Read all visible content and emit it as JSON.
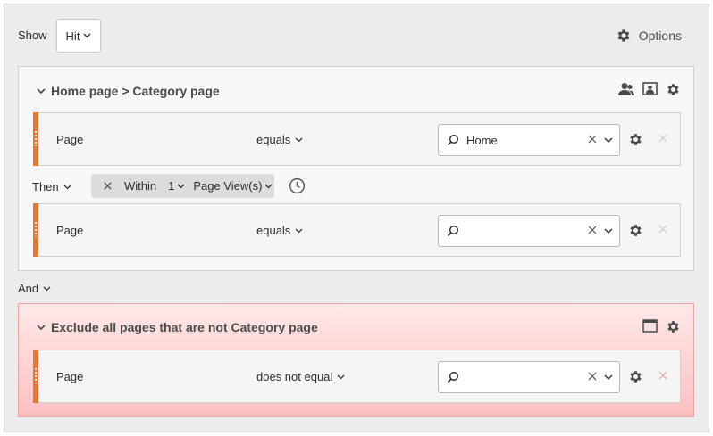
{
  "toolbar": {
    "show_label": "Show",
    "show_value": "Hit",
    "options_label": "Options"
  },
  "sequence_container": {
    "title": "Home page > Category page",
    "rules": [
      {
        "field": "Page",
        "operator": "equals",
        "value": "Home",
        "placeholder": ""
      },
      {
        "field": "Page",
        "operator": "equals",
        "value": "",
        "placeholder": ""
      }
    ],
    "then": {
      "label": "Then",
      "within_label": "Within",
      "within_count": "1",
      "within_unit": "Page View(s)"
    }
  },
  "logic_operator": "And",
  "exclude_container": {
    "title": "Exclude all pages that are not Category page",
    "rules": [
      {
        "field": "Page",
        "operator": "does not equal",
        "value": "",
        "placeholder": ""
      }
    ]
  },
  "colors": {
    "accent_handle": "#e37a33",
    "exclude_bg": "#fcc0c0",
    "panel_bg": "#ececec"
  },
  "icons": [
    "gear-icon",
    "chevron-down-icon",
    "user-icon",
    "screen-icon",
    "search-icon",
    "clear-icon",
    "close-icon",
    "clock-icon",
    "window-icon"
  ]
}
